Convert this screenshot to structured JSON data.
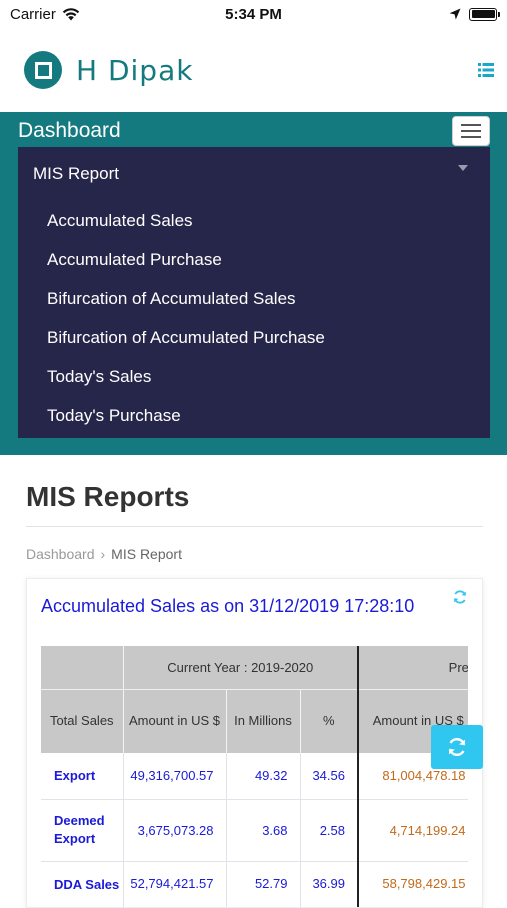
{
  "status_bar": {
    "carrier": "Carrier",
    "time": "5:34 PM"
  },
  "header": {
    "brand_name": "H Dipak",
    "brand_color": "#157a80"
  },
  "dashboard": {
    "title": "Dashboard",
    "menu": {
      "selected": "MIS Report",
      "items": [
        "Accumulated Sales",
        "Accumulated Purchase",
        "Bifurcation of Accumulated Sales",
        "Bifurcation of Accumulated Purchase",
        "Today's Sales",
        "Today's Purchase"
      ]
    }
  },
  "page": {
    "title": "MIS Reports",
    "breadcrumb": {
      "root": "Dashboard",
      "separator": "›",
      "current": "MIS Report"
    }
  },
  "card": {
    "title": "Accumulated Sales as on 31/12/2019 17:28:10",
    "table": {
      "group_headers": {
        "current": "Current Year : 2019-2020",
        "previous": "Previous Y"
      },
      "columns": {
        "total_sales": "Total Sales",
        "amount_us": "Amount in US $",
        "in_millions": "In Millions",
        "percent": "%",
        "prev_amount_us": "Amount in US $"
      },
      "rows": [
        {
          "label": "Export",
          "amount": "49,316,700.57",
          "millions": "49.32",
          "percent": "34.56",
          "prev_amount": "81,004,478.18"
        },
        {
          "label": "Deemed Export",
          "amount": "3,675,073.28",
          "millions": "3.68",
          "percent": "2.58",
          "prev_amount": "4,714,199.24"
        },
        {
          "label": "DDA Sales",
          "amount": "52,794,421.57",
          "millions": "52.79",
          "percent": "36.99",
          "prev_amount": "58,798,429.15"
        }
      ]
    }
  },
  "colors": {
    "teal": "#157a80",
    "menu_bg": "#26264a",
    "link_blue": "#1a1ad8",
    "prev_year_orange": "#c26a1a",
    "refresh_button": "#2fc6f0"
  }
}
